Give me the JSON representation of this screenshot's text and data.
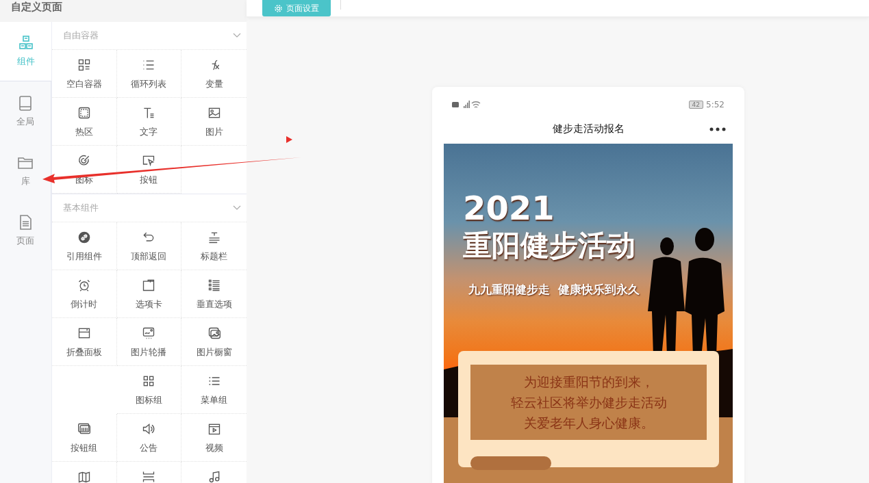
{
  "header": {
    "title": "自定义页面"
  },
  "nav": [
    {
      "label": "组件",
      "selected": true
    },
    {
      "label": "全局",
      "selected": false
    },
    {
      "label": "库",
      "selected": false
    },
    {
      "label": "页面",
      "selected": false
    }
  ],
  "sections": [
    {
      "title": "自由容器",
      "expanded": true,
      "items": [
        {
          "kind": "component",
          "label": "空白容器"
        },
        {
          "kind": "component",
          "label": "循环列表"
        },
        {
          "kind": "component",
          "label": "变量"
        },
        {
          "kind": "component",
          "label": "热区"
        },
        {
          "kind": "component",
          "label": "文字"
        },
        {
          "kind": "component",
          "label": "图片"
        },
        {
          "kind": "component",
          "label": "图标"
        },
        {
          "kind": "component",
          "label": "按钮"
        },
        {
          "kind": "empty"
        }
      ]
    },
    {
      "title": "基本组件",
      "expanded": true,
      "items": [
        {
          "kind": "component",
          "label": "引用组件"
        },
        {
          "kind": "component",
          "label": "顶部返回"
        },
        {
          "kind": "component",
          "label": "标题栏"
        },
        {
          "kind": "component",
          "label": "倒计时"
        },
        {
          "kind": "component",
          "label": "选项卡"
        },
        {
          "kind": "component",
          "label": "垂直选项"
        },
        {
          "kind": "component",
          "label": "折叠面板"
        },
        {
          "kind": "component",
          "label": "图片轮播"
        },
        {
          "kind": "component",
          "label": "图片橱窗"
        },
        {
          "kind": "empty"
        },
        {
          "kind": "component",
          "label": "图标组"
        },
        {
          "kind": "component",
          "label": "菜单组"
        },
        {
          "kind": "component",
          "label": "按钮组"
        },
        {
          "kind": "component",
          "label": "公告"
        },
        {
          "kind": "component",
          "label": "视频"
        },
        {
          "kind": "component"
        },
        {
          "kind": "component"
        },
        {
          "kind": "component"
        }
      ]
    }
  ],
  "toolbar": {
    "button": "页面设置"
  },
  "phone": {
    "battery": "42",
    "time": "5:52",
    "title": "健步走活动报名",
    "poster": {
      "year": "2021",
      "headline": "重阳健步活动",
      "slogan": "九九重阳健步走  健康快乐到永久",
      "notice": [
        "为迎接重阳节的到来，",
        "轻云社区将举办健步走活动",
        "关爱老年人身心健康。"
      ]
    }
  }
}
